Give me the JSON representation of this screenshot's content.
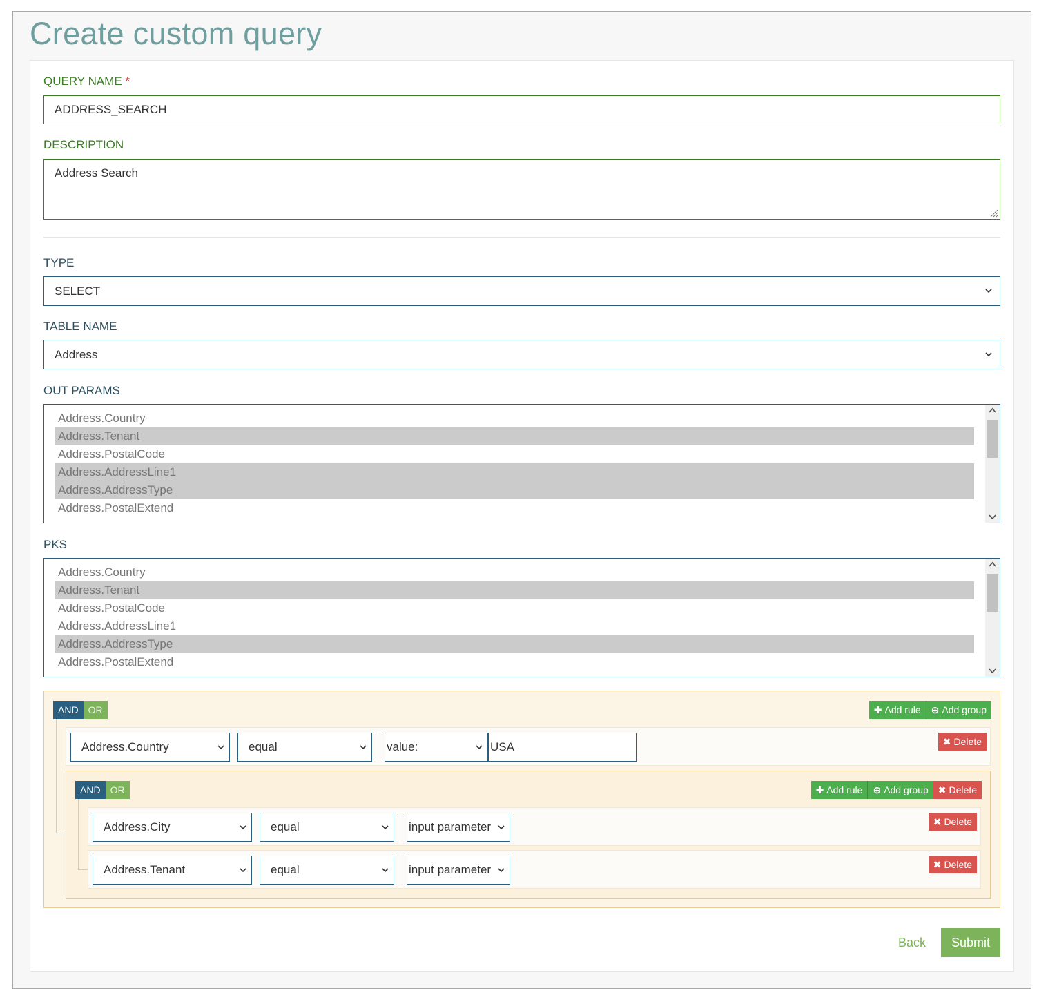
{
  "page": {
    "title": "Create custom query"
  },
  "form": {
    "query_name": {
      "label": "QUERY NAME",
      "required_mark": "*",
      "value": "ADDRESS_SEARCH"
    },
    "description": {
      "label": "DESCRIPTION",
      "value": "Address Search"
    },
    "type": {
      "label": "TYPE",
      "value": "SELECT"
    },
    "table_name": {
      "label": "TABLE NAME",
      "value": "Address"
    },
    "out_params": {
      "label": "OUT PARAMS",
      "options": [
        {
          "text": "Address.Country",
          "selected": false
        },
        {
          "text": "Address.Tenant",
          "selected": true
        },
        {
          "text": "Address.PostalCode",
          "selected": false
        },
        {
          "text": "Address.AddressLine1",
          "selected": true
        },
        {
          "text": "Address.AddressType",
          "selected": true
        },
        {
          "text": "Address.PostalExtend",
          "selected": false
        }
      ]
    },
    "pks": {
      "label": "PKS",
      "options": [
        {
          "text": "Address.Country",
          "selected": false
        },
        {
          "text": "Address.Tenant",
          "selected": true
        },
        {
          "text": "Address.PostalCode",
          "selected": false
        },
        {
          "text": "Address.AddressLine1",
          "selected": false
        },
        {
          "text": "Address.AddressType",
          "selected": true
        },
        {
          "text": "Address.PostalExtend",
          "selected": false
        }
      ]
    }
  },
  "query_builder": {
    "root": {
      "and_label": "AND",
      "or_label": "OR",
      "add_rule_label": "Add rule",
      "add_group_label": "Add group",
      "rules": [
        {
          "field": "Address.Country",
          "operator": "equal",
          "value_type": "value:",
          "value": "USA",
          "delete_label": "Delete"
        }
      ]
    },
    "subgroup": {
      "and_label": "AND",
      "or_label": "OR",
      "add_rule_label": "Add rule",
      "add_group_label": "Add group",
      "delete_label": "Delete",
      "rules": [
        {
          "field": "Address.City",
          "operator": "equal",
          "value_type": "input parameter",
          "delete_label": "Delete"
        },
        {
          "field": "Address.Tenant",
          "operator": "equal",
          "value_type": "input parameter",
          "delete_label": "Delete"
        }
      ]
    }
  },
  "actions": {
    "back_label": "Back",
    "submit_label": "Submit"
  },
  "colors": {
    "title": "#6f9e9e",
    "label_green": "#3b7d23",
    "primary": "#2a5f80",
    "success": "#4cae4c",
    "danger": "#d9534f",
    "submit": "#7db45b"
  },
  "icons": {
    "plus": "plus-icon",
    "plus_circle": "plus-circle-icon",
    "remove": "remove-icon",
    "chevron": "chevron-down-icon"
  }
}
